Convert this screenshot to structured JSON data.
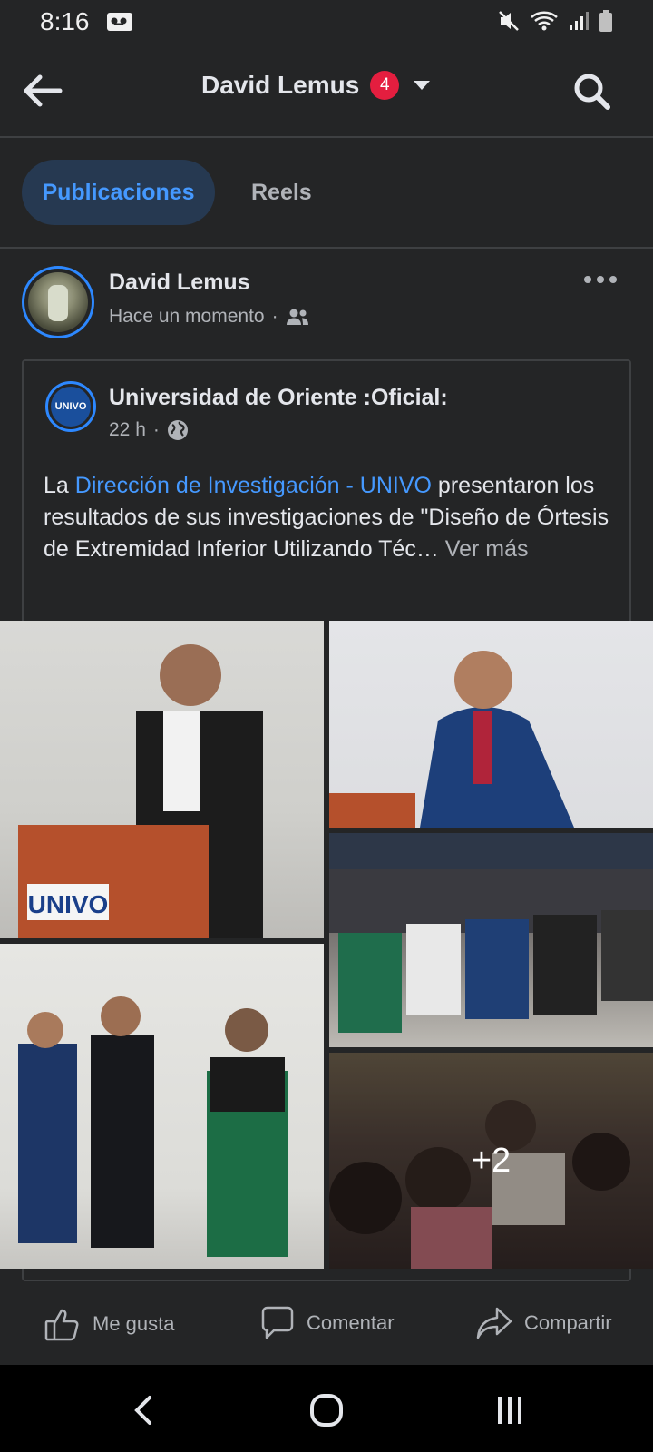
{
  "status_bar": {
    "time": "8:16",
    "left_icon": "voicemail-icon",
    "right_icons": [
      "mute-icon",
      "wifi-icon",
      "signal-icon",
      "battery-icon"
    ]
  },
  "header": {
    "title": "David Lemus",
    "badge_count": "4",
    "back_icon": "arrow-left-icon",
    "search_icon": "search-icon",
    "dropdown_icon": "caret-down-icon"
  },
  "tabs": [
    {
      "label": "Publicaciones",
      "active": true
    },
    {
      "label": "Reels",
      "active": false
    }
  ],
  "post": {
    "author": "David Lemus",
    "time": "Hace un momento",
    "separator": "·",
    "audience_icon": "friends-icon",
    "shared": {
      "page_name": "Universidad de Oriente :Oficial:",
      "page_avatar_text": "UNIVO",
      "time": "22 h",
      "separator": "·",
      "audience_icon": "globe-icon",
      "text_prefix": "La ",
      "text_link": "Dirección de Investigación - UNIVO",
      "text_body": "  presentaron los resultados de sus investigaciones de \"Diseño de Órtesis de Extremidad Inferior Utilizando Téc…",
      "see_more": " Ver más",
      "more_photos": "+2"
    }
  },
  "actions": {
    "like": "Me gusta",
    "comment": "Comentar",
    "share": "Compartir"
  },
  "colors": {
    "background": "#242526",
    "accent": "#2d88ff",
    "link": "#4599ff",
    "badge": "#e41e3f",
    "tab_active_bg": "#263951"
  }
}
